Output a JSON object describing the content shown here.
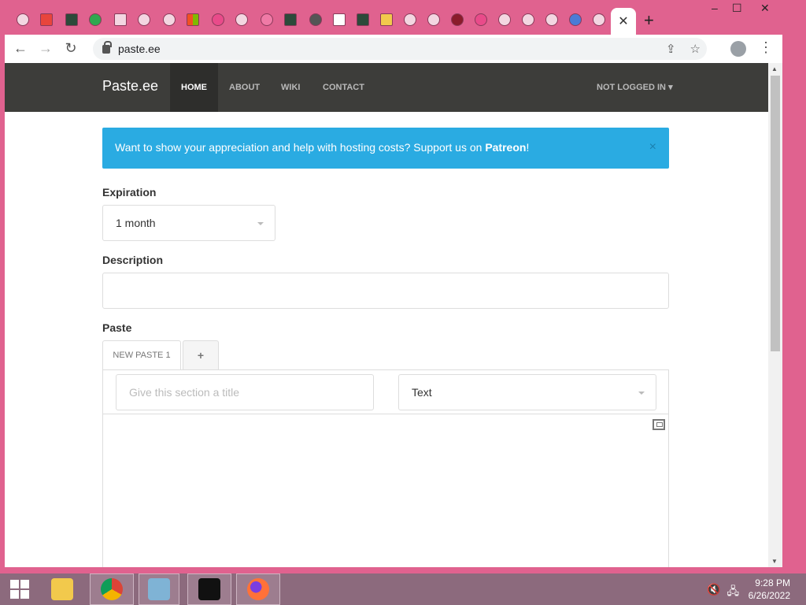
{
  "browser": {
    "url": "paste.ee",
    "active_tab_close": "✕",
    "new_tab": "+",
    "window_controls": {
      "minimize": "–",
      "maximize": "☐",
      "close": "✕"
    },
    "tabs": [
      "globe",
      "red-app",
      "sqlite",
      "n-app",
      "download",
      "globe",
      "globe",
      "windows",
      "circle",
      "globe",
      "pink",
      "sqlite",
      "chrome",
      "square-app",
      "sqlite",
      "folder",
      "gear",
      "globe",
      "rebel",
      "circle",
      "globe",
      "globe",
      "gear",
      "cloud",
      "globe"
    ]
  },
  "site": {
    "brand": "Paste.ee",
    "nav": [
      "HOME",
      "ABOUT",
      "WIKI",
      "CONTACT"
    ],
    "user_menu": "NOT LOGGED IN"
  },
  "alert": {
    "text": "Want to show your appreciation and help with hosting costs? Support us on ",
    "link": "Patreon",
    "end": "!",
    "close": "×"
  },
  "form": {
    "expiration_label": "Expiration",
    "expiration_value": "1 month",
    "description_label": "Description",
    "description_value": "",
    "paste_label": "Paste",
    "tab_label": "NEW PASTE 1",
    "add_tab": "+",
    "section_title_placeholder": "Give this section a title",
    "syntax_value": "Text"
  },
  "taskbar": {
    "time": "9:28 PM",
    "date": "6/26/2022"
  },
  "colors": {
    "accent_border": "#e0628f",
    "navbar": "#3d3d3a",
    "alert": "#2aabe2",
    "taskbar": "#8c6a7d"
  }
}
